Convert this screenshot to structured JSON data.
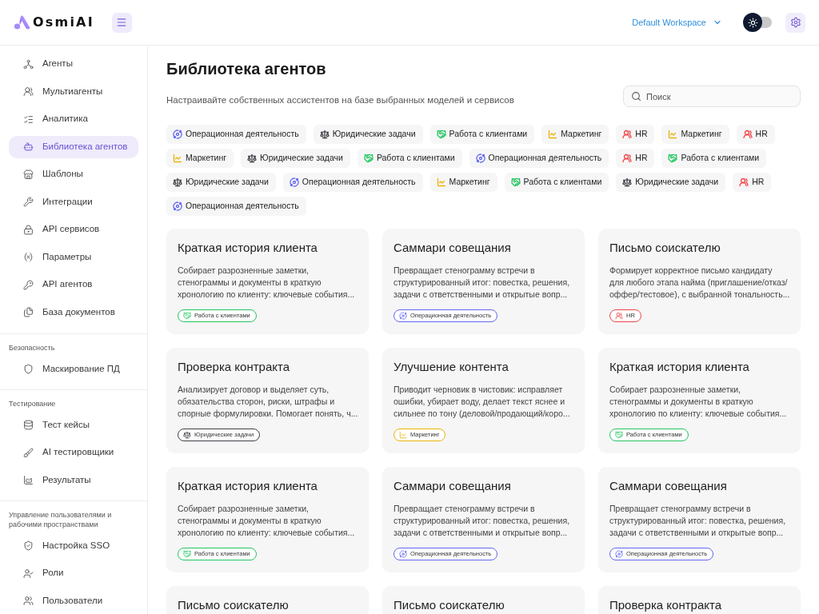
{
  "header": {
    "logo": "OsmiAI",
    "workspace": "Default Workspace",
    "theme_toggle": {
      "on": false
    }
  },
  "sidebar": {
    "sections": [
      {
        "items": [
          {
            "label": "Агенты",
            "selected": false
          },
          {
            "label": "Мультиагенты",
            "selected": false
          },
          {
            "label": "Аналитика",
            "selected": false
          },
          {
            "label": "Библиотека агентов",
            "selected": true
          },
          {
            "label": "Шаблоны",
            "selected": false
          },
          {
            "label": "Интеграции",
            "selected": false
          },
          {
            "label": "API сервисов",
            "selected": false
          },
          {
            "label": "Параметры",
            "selected": false
          },
          {
            "label": "API агентов",
            "selected": false
          },
          {
            "label": "База документов",
            "selected": false
          }
        ]
      },
      {
        "title": "Безопасность",
        "items": [
          {
            "label": "Маскирование ПД",
            "selected": false
          }
        ]
      },
      {
        "title": "Тестирование",
        "items": [
          {
            "label": "Тест кейсы",
            "selected": false
          },
          {
            "label": "AI тестировщики",
            "selected": false
          },
          {
            "label": "Результаты",
            "selected": false
          }
        ]
      },
      {
        "title": "Управление пользователями и рабочими пространствами",
        "items": [
          {
            "label": "Настройка SSO",
            "selected": false
          },
          {
            "label": "Роли",
            "selected": false
          },
          {
            "label": "Пользователи",
            "selected": false
          }
        ]
      }
    ]
  },
  "page": {
    "title": "Библиотека агентов",
    "description": "Настраивайте собственных ассистентов на базе выбранных моделей и сервисов",
    "search": {
      "placeholder": "Поиск"
    }
  },
  "tags": [
    {
      "label": "Операционная деятельность",
      "kind": "operations",
      "color": "#6366f1"
    },
    {
      "label": "Юридические задачи",
      "kind": "legal",
      "color": "#3f3f46"
    },
    {
      "label": "Работа с клиентами",
      "kind": "clients",
      "color": "#22c55e"
    },
    {
      "label": "Маркетинг",
      "kind": "marketing",
      "color": "#eab308"
    },
    {
      "label": "HR",
      "kind": "hr",
      "color": "#ef4444"
    },
    {
      "label": "Маркетинг",
      "kind": "marketing",
      "color": "#eab308"
    },
    {
      "label": "HR",
      "kind": "hr",
      "color": "#ef4444"
    },
    {
      "label": "Маркетинг",
      "kind": "marketing",
      "color": "#eab308"
    },
    {
      "label": "Юридические задачи",
      "kind": "legal",
      "color": "#3f3f46"
    },
    {
      "label": "Работа с клиентами",
      "kind": "clients",
      "color": "#22c55e"
    },
    {
      "label": "Операционная деятельность",
      "kind": "operations",
      "color": "#6366f1"
    },
    {
      "label": "HR",
      "kind": "hr",
      "color": "#ef4444"
    },
    {
      "label": "Работа с клиентами",
      "kind": "clients",
      "color": "#22c55e"
    },
    {
      "label": "Юридические задачи",
      "kind": "legal",
      "color": "#3f3f46"
    },
    {
      "label": "Операционная деятельность",
      "kind": "operations",
      "color": "#6366f1"
    },
    {
      "label": "Маркетинг",
      "kind": "marketing",
      "color": "#eab308"
    },
    {
      "label": "Работа с клиентами",
      "kind": "clients",
      "color": "#22c55e"
    },
    {
      "label": "Юридические задачи",
      "kind": "legal",
      "color": "#3f3f46"
    },
    {
      "label": "HR",
      "kind": "hr",
      "color": "#ef4444"
    },
    {
      "label": "Операционная деятельность",
      "kind": "operations",
      "color": "#6366f1"
    }
  ],
  "cards": [
    {
      "title": "Краткая история клиента",
      "description": "Собирает разрозненные заметки,\nстенограммы и документы в краткую\nхронологию по клиенту: ключевые события...",
      "tag": {
        "label": "Работа с клиентами",
        "kind": "clients",
        "color": "#22c55e"
      }
    },
    {
      "title": "Саммари совещания",
      "description": "Превращает стенограмму встречи в\nструктурированный итог: повестка, решения,\nзадачи с ответственными и открытые вопр...",
      "tag": {
        "label": "Операционная деятельность",
        "kind": "operations",
        "color": "#6366f1"
      }
    },
    {
      "title": "Письмо соискателю",
      "description": "Формирует корректное письмо кандидату\nдля любого этапа найма (приглашение/отказ/\nоффер/тестовое), с выбранной тональность...",
      "tag": {
        "label": "HR",
        "kind": "hr",
        "color": "#ef4444"
      }
    },
    {
      "title": "Проверка контракта",
      "description": "Анализирует договор и выделяет суть,\nобязательства сторон, риски, штрафы и\nспорные формулировки. Помогает понять, ч...",
      "tag": {
        "label": "Юридические задачи",
        "kind": "legal",
        "color": "#3f3f46"
      }
    },
    {
      "title": "Улучшение контента",
      "description": "Приводит черновик в чистовик: исправляет\nошибки, убирает воду, делает текст яснее и\nсильнее по тону (деловой/продающий/коро...",
      "tag": {
        "label": "Маркетинг",
        "kind": "marketing",
        "color": "#eab308"
      }
    },
    {
      "title": "Краткая история клиента",
      "description": "Собирает разрозненные заметки,\nстенограммы и документы в краткую\nхронологию по клиенту: ключевые события...",
      "tag": {
        "label": "Работа с клиентами",
        "kind": "clients",
        "color": "#22c55e"
      }
    },
    {
      "title": "Краткая история клиента",
      "description": "Собирает разрозненные заметки,\nстенограммы и документы в краткую\nхронологию по клиенту: ключевые события...",
      "tag": {
        "label": "Работа с клиентами",
        "kind": "clients",
        "color": "#22c55e"
      }
    },
    {
      "title": "Саммари совещания",
      "description": "Превращает стенограмму встречи в\nструктурированный итог: повестка, решения,\nзадачи с ответственными и открытые вопр...",
      "tag": {
        "label": "Операционная деятельность",
        "kind": "operations",
        "color": "#6366f1"
      }
    },
    {
      "title": "Саммари совещания",
      "description": "Превращает стенограмму встречи в\nструктурированный итог: повестка, решения,\nзадачи с ответственными и открытые вопр...",
      "tag": {
        "label": "Операционная деятельность",
        "kind": "operations",
        "color": "#6366f1"
      }
    },
    {
      "title": "Письмо соискателю"
    },
    {
      "title": "Письмо соискателю"
    },
    {
      "title": "Проверка контракта"
    }
  ]
}
